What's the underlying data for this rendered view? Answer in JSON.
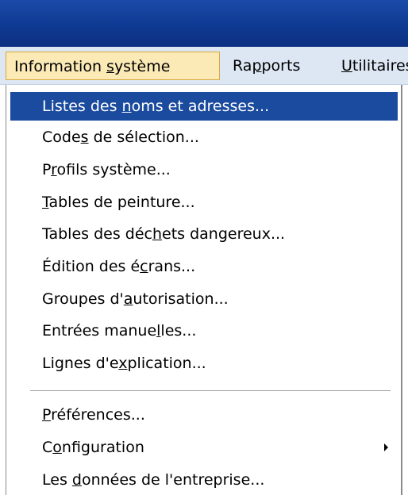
{
  "menubar": {
    "items": [
      {
        "label": "Information système",
        "mnemonic": "s"
      },
      {
        "label": "Rapports",
        "mnemonic": "p"
      },
      {
        "label": "Utilitaires",
        "mnemonic": "U"
      }
    ]
  },
  "dropdown": {
    "items": [
      {
        "pre": "Listes des ",
        "u": "n",
        "post": "oms et adresses..."
      },
      {
        "pre": "Code",
        "u": "s",
        "post": " de sélection..."
      },
      {
        "pre": "P",
        "u": "r",
        "post": "ofils système..."
      },
      {
        "pre": "",
        "u": "T",
        "post": "ables de peinture..."
      },
      {
        "pre": "Tables des déc",
        "u": "h",
        "post": "ets dangereux..."
      },
      {
        "pre": "Édition des é",
        "u": "c",
        "post": "rans..."
      },
      {
        "pre": "Groupes d'",
        "u": "a",
        "post": "utorisation..."
      },
      {
        "pre": "Entrées manue",
        "u": "l",
        "post": "les..."
      },
      {
        "pre": "Lignes d'e",
        "u": "x",
        "post": "plication..."
      },
      {
        "pre": "",
        "u": "P",
        "post": "références..."
      },
      {
        "pre": "C",
        "u": "o",
        "post": "nfiguration"
      },
      {
        "pre": "Les ",
        "u": "d",
        "post": "onnées de l'entreprise..."
      }
    ]
  },
  "colors": {
    "titlebar": "#0f3a92",
    "menubar": "#dde7f4",
    "open_menu": "#fbe9b6",
    "highlight": "#1b4b9e"
  },
  "icons": {
    "submenu": "chevron-right-icon"
  }
}
